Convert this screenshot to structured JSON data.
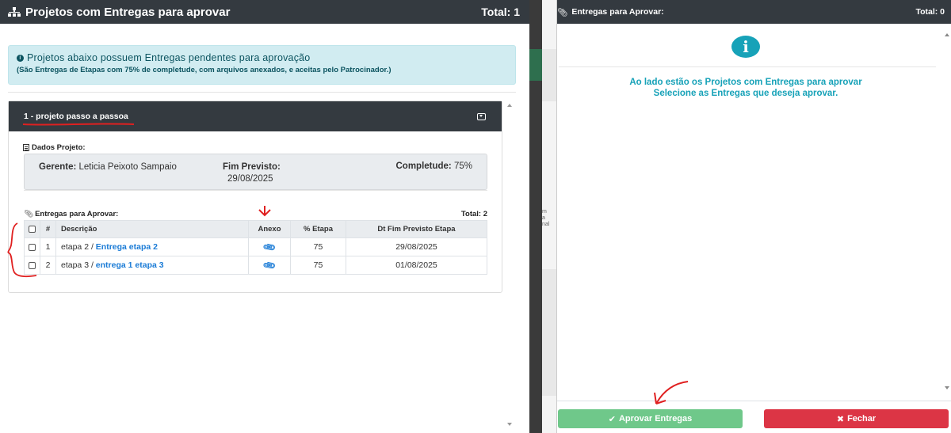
{
  "left_panel": {
    "title": "Projetos com Entregas para aprovar",
    "total": "Total: 1",
    "info_line1": "Projetos abaixo possuem Entregas pendentes para aprovação",
    "info_line2": "(São Entregas de Etapas com 75% de completude, com arquivos anexados, e aceitas pelo Patrocinador.)",
    "project": {
      "title": "1 - projeto passo a passoa",
      "dados_label": "Dados Projeto:",
      "gerente_label": "Gerente:",
      "gerente_value": "Leticia Peixoto Sampaio",
      "fim_label": "Fim Previsto:",
      "fim_value": "29/08/2025",
      "completude_label": "Completude:",
      "completude_value": "75%",
      "entregas_label": "Entregas para Aprovar:",
      "entregas_total": "Total: 2",
      "columns": [
        "#",
        "Descrição",
        "Anexo",
        "% Etapa",
        "Dt Fim Previsto Etapa"
      ],
      "rows": [
        {
          "num": "1",
          "etapa": "etapa 2 / ",
          "entrega": "Entrega etapa 2",
          "etapa_pct": "75",
          "dt": "29/08/2025"
        },
        {
          "num": "2",
          "etapa": "etapa 3 / ",
          "entrega": "entrega 1 etapa 3",
          "etapa_pct": "75",
          "dt": "01/08/2025"
        }
      ]
    }
  },
  "right_panel": {
    "title": "Entregas para Aprovar:",
    "total": "Total: 0",
    "msg_line1": "Ao lado estão os Projetos com Entregas para aprovar",
    "msg_line2": "Selecione as Entregas que deseja aprovar.",
    "approve_label": "Aprovar Entregas",
    "close_label": "Fechar"
  },
  "peek": {
    "text": "m\na\nnal"
  },
  "colors": {
    "header_dark": "#343a40",
    "info_bg": "#d1ecf1",
    "accent_teal": "#17a2b8",
    "link_blue": "#1a7bd6",
    "approve_green": "#6fc88a",
    "close_red": "#dc3545",
    "annotation_red": "#e02020"
  }
}
